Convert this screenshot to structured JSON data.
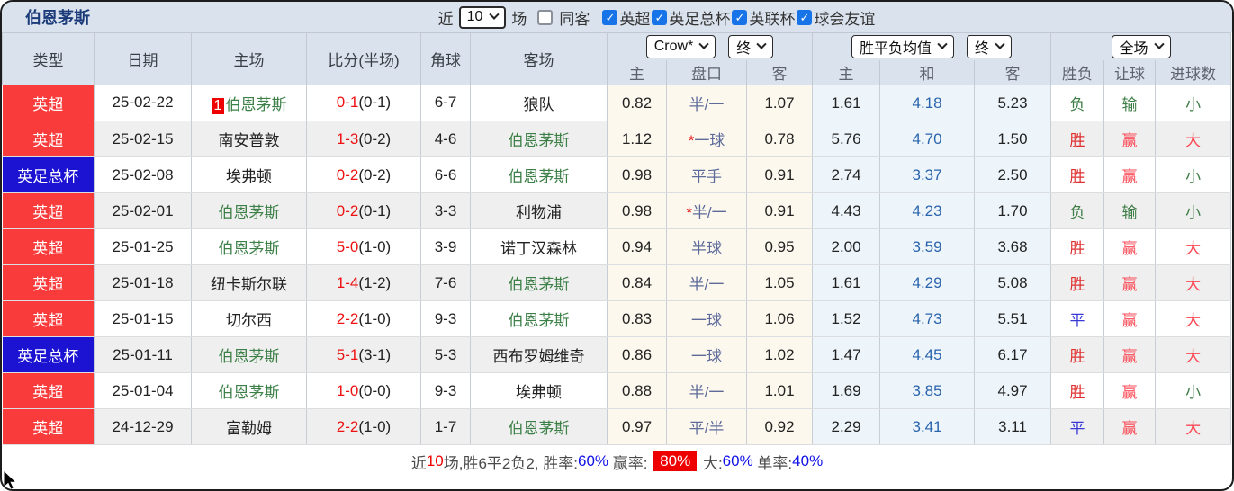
{
  "title": "伯恩茅斯",
  "filter_bar": {
    "recent_label": "近",
    "recent_value": "10",
    "matches_label": "场",
    "same_opponent": {
      "label": "同客",
      "checked": false
    },
    "leagues": [
      {
        "label": "英超",
        "checked": true
      },
      {
        "label": "英足总杯",
        "checked": true
      },
      {
        "label": "英联杯",
        "checked": true
      },
      {
        "label": "球会友谊",
        "checked": true
      }
    ]
  },
  "table": {
    "left_headers": [
      "类型",
      "日期",
      "主场",
      "比分(半场)",
      "角球",
      "客场"
    ],
    "selects": {
      "company": "Crow*",
      "final1": "终",
      "avg": "胜平负均值",
      "final2": "终",
      "scope": "全场"
    },
    "sub_headers": [
      "主",
      "盘口",
      "客",
      "主",
      "和",
      "客",
      "胜负",
      "让球",
      "进球数"
    ],
    "rows": [
      {
        "type": "英超",
        "type_color": "red",
        "date": "25-02-22",
        "home": "伯恩茅斯",
        "home_green": true,
        "home_badge": "1",
        "home_underline": false,
        "ft": "0-1",
        "ht": "(0-1)",
        "corner": "6-7",
        "away": "狼队",
        "away_green": false,
        "crow_home": "0.82",
        "handicap": "半/一",
        "handicap_star": false,
        "crow_away": "1.07",
        "avg_home": "1.61",
        "avg_draw": "4.18",
        "avg_away": "5.23",
        "result": "负",
        "result_color": "green",
        "let": "输",
        "let_color": "green",
        "goals": "小",
        "goals_color": "green"
      },
      {
        "type": "英超",
        "type_color": "red",
        "date": "25-02-15",
        "home": "南安普敦",
        "home_green": false,
        "home_badge": "",
        "home_underline": true,
        "ft": "1-3",
        "ht": "(0-2)",
        "corner": "4-6",
        "away": "伯恩茅斯",
        "away_green": true,
        "crow_home": "1.12",
        "handicap": "一球",
        "handicap_star": true,
        "crow_away": "0.78",
        "avg_home": "5.76",
        "avg_draw": "4.70",
        "avg_away": "1.50",
        "result": "胜",
        "result_color": "red",
        "let": "赢",
        "let_color": "pink",
        "goals": "大",
        "goals_color": "pink"
      },
      {
        "type": "英足总杯",
        "type_color": "blue",
        "date": "25-02-08",
        "home": "埃弗顿",
        "home_green": false,
        "home_badge": "",
        "home_underline": false,
        "ft": "0-2",
        "ht": "(0-2)",
        "corner": "6-6",
        "away": "伯恩茅斯",
        "away_green": true,
        "crow_home": "0.98",
        "handicap": "平手",
        "handicap_star": false,
        "crow_away": "0.91",
        "avg_home": "2.74",
        "avg_draw": "3.37",
        "avg_away": "2.50",
        "result": "胜",
        "result_color": "red",
        "let": "赢",
        "let_color": "pink",
        "goals": "小",
        "goals_color": "green"
      },
      {
        "type": "英超",
        "type_color": "red",
        "date": "25-02-01",
        "home": "伯恩茅斯",
        "home_green": true,
        "home_badge": "",
        "home_underline": false,
        "ft": "0-2",
        "ht": "(0-1)",
        "corner": "3-3",
        "away": "利物浦",
        "away_green": false,
        "crow_home": "0.98",
        "handicap": "半/一",
        "handicap_star": true,
        "crow_away": "0.91",
        "avg_home": "4.43",
        "avg_draw": "4.23",
        "avg_away": "1.70",
        "result": "负",
        "result_color": "green",
        "let": "输",
        "let_color": "green",
        "goals": "小",
        "goals_color": "green"
      },
      {
        "type": "英超",
        "type_color": "red",
        "date": "25-01-25",
        "home": "伯恩茅斯",
        "home_green": true,
        "home_badge": "",
        "home_underline": false,
        "ft": "5-0",
        "ht": "(1-0)",
        "corner": "3-9",
        "away": "诺丁汉森林",
        "away_green": false,
        "crow_home": "0.94",
        "handicap": "半球",
        "handicap_star": false,
        "crow_away": "0.95",
        "avg_home": "2.00",
        "avg_draw": "3.59",
        "avg_away": "3.68",
        "result": "胜",
        "result_color": "red",
        "let": "赢",
        "let_color": "pink",
        "goals": "大",
        "goals_color": "pink"
      },
      {
        "type": "英超",
        "type_color": "red",
        "date": "25-01-18",
        "home": "纽卡斯尔联",
        "home_green": false,
        "home_badge": "",
        "home_underline": false,
        "ft": "1-4",
        "ht": "(1-2)",
        "corner": "7-6",
        "away": "伯恩茅斯",
        "away_green": true,
        "crow_home": "0.84",
        "handicap": "半/一",
        "handicap_star": false,
        "crow_away": "1.05",
        "avg_home": "1.61",
        "avg_draw": "4.29",
        "avg_away": "5.08",
        "result": "胜",
        "result_color": "red",
        "let": "赢",
        "let_color": "pink",
        "goals": "大",
        "goals_color": "pink"
      },
      {
        "type": "英超",
        "type_color": "red",
        "date": "25-01-15",
        "home": "切尔西",
        "home_green": false,
        "home_badge": "",
        "home_underline": false,
        "ft": "2-2",
        "ht": "(1-0)",
        "corner": "9-3",
        "away": "伯恩茅斯",
        "away_green": true,
        "crow_home": "0.83",
        "handicap": "一球",
        "handicap_star": false,
        "crow_away": "1.06",
        "avg_home": "1.52",
        "avg_draw": "4.73",
        "avg_away": "5.51",
        "result": "平",
        "result_color": "blue",
        "let": "赢",
        "let_color": "pink",
        "goals": "大",
        "goals_color": "pink"
      },
      {
        "type": "英足总杯",
        "type_color": "blue",
        "date": "25-01-11",
        "home": "伯恩茅斯",
        "home_green": true,
        "home_badge": "",
        "home_underline": false,
        "ft": "5-1",
        "ht": "(3-1)",
        "corner": "5-3",
        "away": "西布罗姆维奇",
        "away_green": false,
        "crow_home": "0.86",
        "handicap": "一球",
        "handicap_star": false,
        "crow_away": "1.02",
        "avg_home": "1.47",
        "avg_draw": "4.45",
        "avg_away": "6.17",
        "result": "胜",
        "result_color": "red",
        "let": "赢",
        "let_color": "pink",
        "goals": "大",
        "goals_color": "pink"
      },
      {
        "type": "英超",
        "type_color": "red",
        "date": "25-01-04",
        "home": "伯恩茅斯",
        "home_green": true,
        "home_badge": "",
        "home_underline": false,
        "ft": "1-0",
        "ht": "(0-0)",
        "corner": "9-3",
        "away": "埃弗顿",
        "away_green": false,
        "crow_home": "0.88",
        "handicap": "半/一",
        "handicap_star": false,
        "crow_away": "1.01",
        "avg_home": "1.69",
        "avg_draw": "3.85",
        "avg_away": "4.97",
        "result": "胜",
        "result_color": "red",
        "let": "赢",
        "let_color": "pink",
        "goals": "小",
        "goals_color": "green"
      },
      {
        "type": "英超",
        "type_color": "red",
        "date": "24-12-29",
        "home": "富勒姆",
        "home_green": false,
        "home_badge": "",
        "home_underline": false,
        "ft": "2-2",
        "ht": "(1-0)",
        "corner": "1-7",
        "away": "伯恩茅斯",
        "away_green": true,
        "crow_home": "0.97",
        "handicap": "平/半",
        "handicap_star": false,
        "crow_away": "0.92",
        "avg_home": "2.29",
        "avg_draw": "3.41",
        "avg_away": "3.11",
        "result": "平",
        "result_color": "blue",
        "let": "赢",
        "let_color": "pink",
        "goals": "大",
        "goals_color": "pink"
      }
    ]
  },
  "footer": {
    "segments": [
      {
        "text": "近",
        "style": "dark"
      },
      {
        "text": "10",
        "style": "red"
      },
      {
        "text": "场,胜6平2负2, 胜率:",
        "style": "dark"
      },
      {
        "text": "60%",
        "style": "blue"
      },
      {
        "text": " 赢率: ",
        "style": "dark"
      },
      {
        "text": "80%",
        "style": "badge"
      },
      {
        "text": " 大:",
        "style": "dark"
      },
      {
        "text": "60%",
        "style": "blue"
      },
      {
        "text": " 单率:",
        "style": "dark"
      },
      {
        "text": "40%",
        "style": "blue"
      }
    ]
  },
  "colors": {
    "accent_checkbox": "#1674e8",
    "league_red": "#f93b3b",
    "league_blue": "#1b12d2",
    "team_green": "#3c8047",
    "score_red": "#ee1111",
    "handicap_slate": "#5d6b9b",
    "draw_odds_blue": "#2a64ad",
    "header_bg": "#dae2ed"
  }
}
